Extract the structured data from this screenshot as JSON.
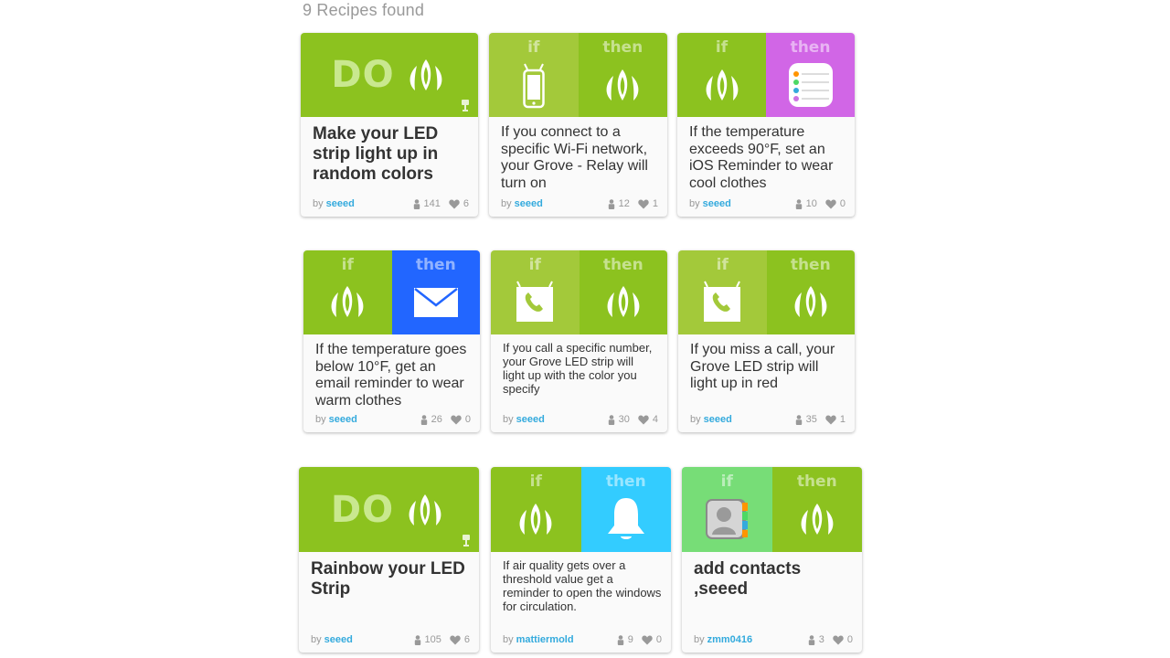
{
  "results_header": "9 Recipes found",
  "by_label": "by",
  "colors": {
    "green": "#8cc21f",
    "light_green": "#a3c93a",
    "bright_green": "#77dd77",
    "purple": "#d166e6",
    "blue": "#2266ff",
    "sky_blue": "#33ccff"
  },
  "recipes": [
    {
      "type": "do",
      "title": "Make your LED strip light up in random colors",
      "author": "seeed",
      "uses": "141",
      "favorites": "6"
    },
    {
      "type": "if-then",
      "if_label": "if",
      "then_label": "then",
      "trigger_icon": "phone-icon",
      "action_icon": "seeed-logo-icon",
      "title": "If you connect to a specific Wi-Fi network, your Grove - Relay will turn on",
      "author": "seeed",
      "uses": "12",
      "favorites": "1"
    },
    {
      "type": "if-then",
      "if_label": "if",
      "then_label": "then",
      "trigger_icon": "seeed-logo-icon",
      "action_icon": "ios-reminders-icon",
      "title": "If the temperature exceeds 90°F, set an iOS Reminder to wear cool clothes",
      "author": "seeed",
      "uses": "10",
      "favorites": "0"
    },
    {
      "type": "if-then",
      "if_label": "if",
      "then_label": "then",
      "trigger_icon": "seeed-logo-icon",
      "action_icon": "email-icon",
      "title": "If the temperature goes below 10°F, get an email reminder to wear warm clothes",
      "author": "seeed",
      "uses": "26",
      "favorites": "0"
    },
    {
      "type": "if-then",
      "if_label": "if",
      "then_label": "then",
      "trigger_icon": "android-phone-call-icon",
      "action_icon": "seeed-logo-icon",
      "title": "If you call a specific number, your Grove LED strip will light up with the color you specify",
      "author": "seeed",
      "uses": "30",
      "favorites": "4"
    },
    {
      "type": "if-then",
      "if_label": "if",
      "then_label": "then",
      "trigger_icon": "android-phone-call-icon",
      "action_icon": "seeed-logo-icon",
      "title": "If you miss a call, your Grove LED strip will light up in red",
      "author": "seeed",
      "uses": "35",
      "favorites": "1"
    },
    {
      "type": "do",
      "title": "Rainbow your LED Strip",
      "author": "seeed",
      "uses": "105",
      "favorites": "6"
    },
    {
      "type": "if-then",
      "if_label": "if",
      "then_label": "then",
      "trigger_icon": "seeed-logo-icon",
      "action_icon": "notification-bell-icon",
      "title": "If air quality gets over a threshold value get a reminder to open the windows for circulation.",
      "author": "mattiermold",
      "uses": "9",
      "favorites": "0"
    },
    {
      "type": "if-then",
      "if_label": "if",
      "then_label": "then",
      "trigger_icon": "contacts-icon",
      "action_icon": "seeed-logo-icon",
      "title": "add contacts ,seeed",
      "author": "zmm0416",
      "uses": "3",
      "favorites": "0"
    }
  ]
}
